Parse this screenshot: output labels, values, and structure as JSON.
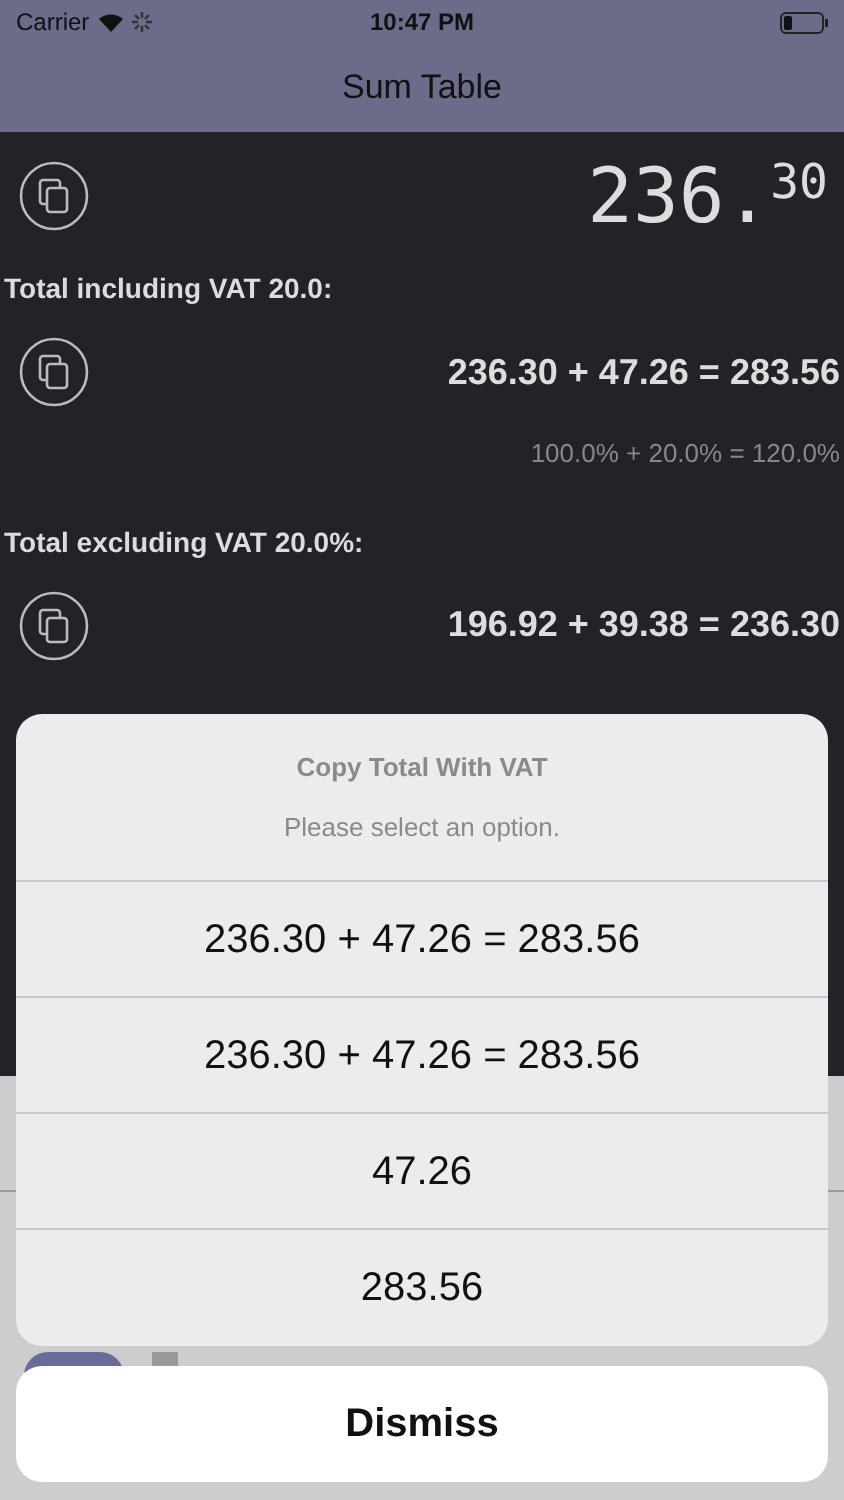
{
  "status_bar": {
    "carrier": "Carrier",
    "time": "10:47 PM"
  },
  "nav": {
    "title": "Sum Table"
  },
  "total": {
    "whole": "236.",
    "fraction": "30"
  },
  "sections": [
    {
      "label": "Total including VAT 20.0:",
      "equation": "236.30 + 47.26 = 283.56",
      "percent": "100.0% + 20.0% = 120.0%"
    },
    {
      "label": "Total excluding VAT 20.0%:",
      "equation": "196.92 + 39.38 = 236.30"
    }
  ],
  "action_sheet": {
    "title": "Copy Total With VAT",
    "message": "Please select an option.",
    "options": [
      "236.30 + 47.26 = 283.56",
      "236.30 + 47.26 = 283.56",
      "47.26",
      "283.56"
    ],
    "cancel": "Dismiss"
  }
}
